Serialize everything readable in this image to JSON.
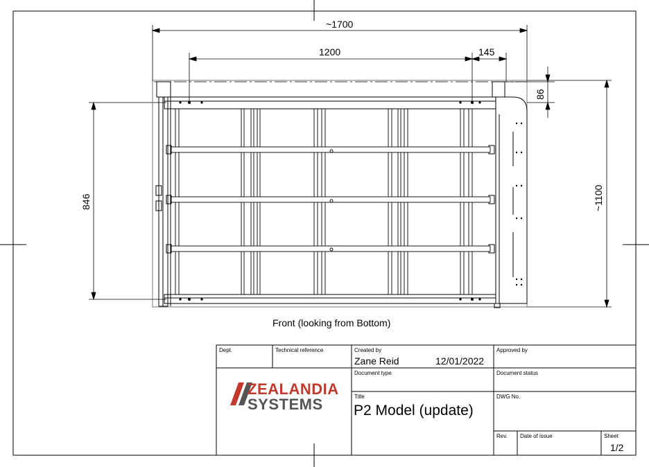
{
  "dimensions": {
    "overall_width": "~1700",
    "inner_width": "1200",
    "offset": "145",
    "top_offset": "86",
    "height_left": "846",
    "height_right": "~1100"
  },
  "view_caption": "Front (looking from Bottom)",
  "title_block": {
    "dept_label": "Dept.",
    "technical_reference_label": "Technical reference",
    "created_by_label": "Created by",
    "created_by_value": "Zane Reid",
    "created_date": "12/01/2022",
    "approved_by_label": "Approved by",
    "document_type_label": "Document type",
    "document_status_label": "Document status",
    "title_label": "Title",
    "title_value": "P2 Model (update)",
    "dwg_no_label": "DWG No.",
    "rev_label": "Rev.",
    "date_of_issue_label": "Date of issue",
    "sheet_label": "Sheet",
    "sheet_value": "1/2"
  },
  "logo": {
    "line1": "ZEALANDIA",
    "line2": "SYSTEMS",
    "brand_color": "#c0392b",
    "secondary_color": "#555555"
  }
}
